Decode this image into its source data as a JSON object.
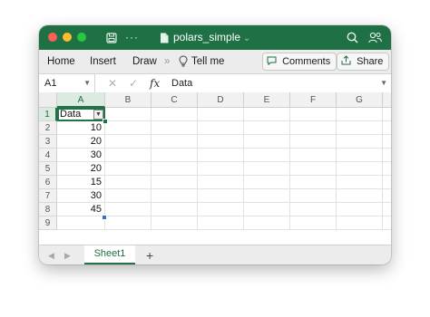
{
  "window": {
    "title": "polars_simple",
    "title_caret": "⌄"
  },
  "titlebar": {
    "save_icon": "save-icon",
    "more_icon": "more-icon",
    "search_icon": "search-icon",
    "share_people_icon": "people-icon"
  },
  "ribbon": {
    "tabs": [
      "Home",
      "Insert",
      "Draw"
    ],
    "overflow": "»",
    "tell_me": "Tell me",
    "comments_label": "Comments",
    "share_label": "Share"
  },
  "formula_bar": {
    "name_box": "A1",
    "fx": "fx",
    "value": "Data"
  },
  "columns": [
    "A",
    "B",
    "C",
    "D",
    "E",
    "F",
    "G"
  ],
  "rows": [
    "1",
    "2",
    "3",
    "4",
    "5",
    "6",
    "7",
    "8",
    "9"
  ],
  "cells": {
    "A1": "Data",
    "A2": "10",
    "A3": "20",
    "A4": "30",
    "A5": "20",
    "A6": "15",
    "A7": "30",
    "A8": "45"
  },
  "sheets": [
    "Sheet1"
  ],
  "add_sheet": "+",
  "colors": {
    "brand": "#1f7145",
    "accent": "#217346"
  }
}
